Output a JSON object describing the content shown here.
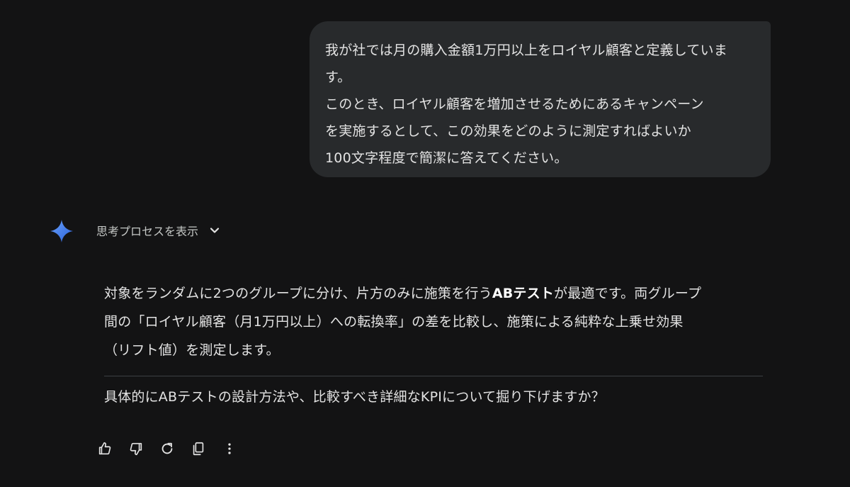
{
  "user_message": {
    "lines": [
      "我が社では月の購入金額1万円以上をロイヤル顧客と定義していま",
      "す。",
      "このとき、ロイヤル顧客を増加させるためにあるキャンペーン",
      "を実施するとして、この効果をどのように測定すればよいか",
      "100文字程度で簡潔に答えてください。"
    ]
  },
  "thinking": {
    "label": "思考プロセスを表示",
    "icon": "chevron-down-icon"
  },
  "response": {
    "line1_part1": "対象をランダムに2つのグループに分け、片方のみに施策を行う",
    "line1_bold": "ABテスト",
    "line1_part2": "が最適です。両グループ",
    "line2": "間の「ロイヤル顧客（月1万円以上）への転換率」の差を比較し、施策による純粋な上乗せ効果",
    "line3": "（リフト値）を測定します。",
    "followup": "具体的にABテストの設計方法や、比較すべき詳細なKPIについて掘り下げますか？"
  },
  "actions": [
    {
      "name": "thumbs-up-icon"
    },
    {
      "name": "thumbs-down-icon"
    },
    {
      "name": "regenerate-icon"
    },
    {
      "name": "copy-icon"
    },
    {
      "name": "more-options-icon"
    }
  ],
  "colors": {
    "background": "#131314",
    "bubble": "#282a2c",
    "text": "#e3e3e3",
    "spark_start": "#4f8ff7",
    "spark_end": "#2d62d8"
  }
}
